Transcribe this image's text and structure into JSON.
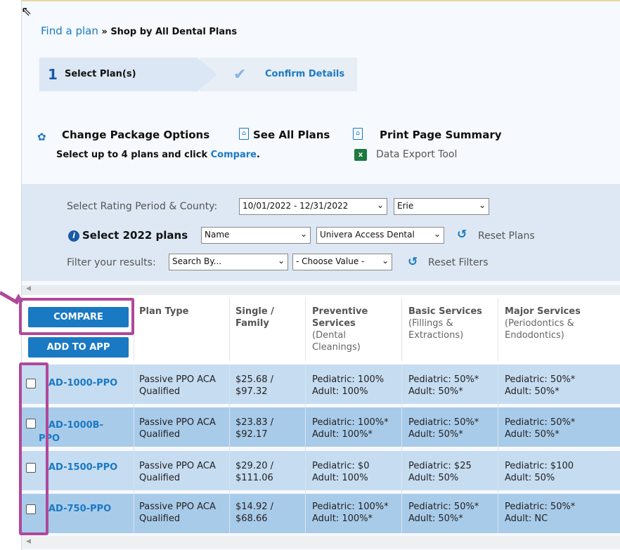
{
  "breadcrumb": {
    "link": "Find a plan",
    "separator": " » ",
    "current": "Shop by All Dental Plans"
  },
  "steps": [
    {
      "number": "1",
      "label": "Select Plan(s)"
    },
    {
      "label": "Confirm Details"
    }
  ],
  "actions": {
    "change_package": "Change Package Options",
    "see_all_plans": "See All Plans",
    "print_summary": "Print Page Summary",
    "select_prefix": "Select up to 4 plans and click ",
    "compare_link": "Compare",
    "select_suffix": ".",
    "data_export": "Data Export Tool"
  },
  "filters": {
    "rating_label": "Select Rating Period & County:",
    "rating_period": "10/01/2022 - 12/31/2022",
    "county": "Erie",
    "select_plans_label": "Select 2022 plans",
    "sort_by": "Name",
    "carrier": "Univera Access Dental",
    "reset_plans": "Reset Plans",
    "filter_label": "Filter your results:",
    "search_by": "Search By...",
    "choose_value": "- Choose Value -",
    "reset_filters": "Reset Filters"
  },
  "table": {
    "compare_button": "COMPARE",
    "add_to_app_button": "ADD TO APP",
    "headers": {
      "plan_type": "Plan Type",
      "single_family": [
        "Single /",
        "Family"
      ],
      "preventive": [
        "Preventive",
        "Services"
      ],
      "preventive_sub": [
        "(Dental",
        "Cleanings)"
      ],
      "basic": "Basic Services",
      "basic_sub": [
        "(Fillings &",
        "Extractions)"
      ],
      "major": "Major Services",
      "major_sub": [
        "(Periodontics &",
        "Endodontics)"
      ]
    },
    "rows": [
      {
        "plan": [
          "AD-1000-PPO"
        ],
        "type": [
          "Passive PPO ACA",
          "Qualified"
        ],
        "price": [
          "$25.68 /",
          "$97.32"
        ],
        "preventive": [
          "Pediatric: 100%",
          "Adult: 100%"
        ],
        "basic": [
          "Pediatric: 50%*",
          "Adult: 50%*"
        ],
        "major": [
          "Pediatric: 50%*",
          "Adult: 50%*"
        ]
      },
      {
        "plan": [
          "AD-1000B-",
          "PPO"
        ],
        "type": [
          "Passive PPO ACA",
          "Qualified"
        ],
        "price": [
          "$23.83 /",
          "$92.17"
        ],
        "preventive": [
          "Pediatric: 100%*",
          "Adult: 100%*"
        ],
        "basic": [
          "Pediatric: 50%*",
          "Adult: 50%*"
        ],
        "major": [
          "Pediatric: 50%*",
          "Adult: 50%*"
        ]
      },
      {
        "plan": [
          "AD-1500-PPO"
        ],
        "type": [
          "Passive PPO ACA",
          "Qualified"
        ],
        "price": [
          "$29.20 /",
          "$111.06"
        ],
        "preventive": [
          "Pediatric: $0",
          "Adult: 100%"
        ],
        "basic": [
          "Pediatric: $25",
          "Adult: 50%"
        ],
        "major": [
          "Pediatric: $100",
          "Adult: 50%"
        ]
      },
      {
        "plan": [
          "AD-750-PPO"
        ],
        "type": [
          "Passive PPO ACA",
          "Qualified"
        ],
        "price": [
          "$14.92 /",
          "$68.66"
        ],
        "preventive": [
          "Pediatric: 100%*",
          "Adult: 100%*"
        ],
        "basic": [
          "Pediatric: 50%*",
          "Adult: 50%*"
        ],
        "major": [
          "Pediatric: 50%*",
          "Adult: NC"
        ]
      }
    ]
  },
  "colors": {
    "accent": "#1a79c3",
    "highlight": "#b0489a",
    "row_light": "#c6dcf1",
    "row_dark": "#a9cbea"
  }
}
